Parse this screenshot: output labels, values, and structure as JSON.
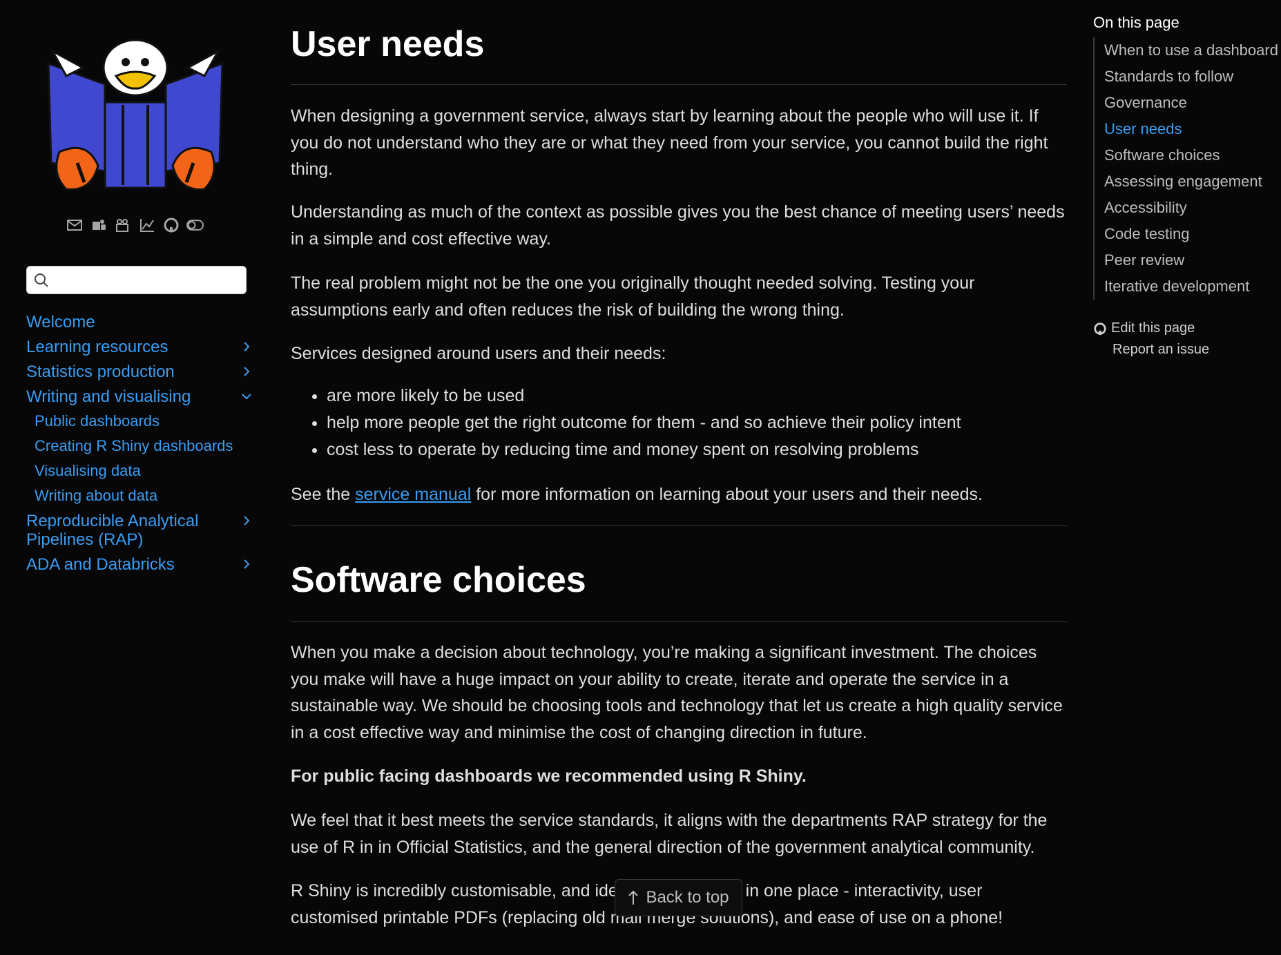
{
  "sidebar": {
    "search": {
      "placeholder": "",
      "value": ""
    },
    "social_icons": [
      "envelope-icon",
      "teams-icon",
      "video-icon",
      "chart-icon",
      "github-icon",
      "toggle-icon"
    ],
    "nav": {
      "welcome": "Welcome",
      "learning_resources": "Learning resources",
      "statistics_production": "Statistics production",
      "writing_visualising": "Writing and visualising",
      "sub": {
        "public_dashboards": "Public dashboards",
        "creating_shiny": "Creating R Shiny dashboards",
        "visualising_data": "Visualising data",
        "writing_about_data": "Writing about data"
      },
      "rap": "Reproducible Analytical Pipelines (RAP)",
      "ada": "ADA and Databricks"
    }
  },
  "main": {
    "section1": {
      "title": "User needs",
      "p1": "When designing a government service, always start by learning about the people who will use it. If you do not understand who they are or what they need from your service, you cannot build the right thing.",
      "p2": "Understanding as much of the context as possible gives you the best chance of meeting users’ needs in a simple and cost effective way.",
      "p3": "The real problem might not be the one you originally thought needed solving. Testing your assumptions early and often reduces the risk of building the wrong thing.",
      "p4": "Services designed around users and their needs:",
      "bullets": [
        "are more likely to be used",
        "help more people get the right outcome for them - and so achieve their policy intent",
        "cost less to operate by reducing time and money spent on resolving problems"
      ],
      "see_pre": "See the ",
      "see_link": "service manual",
      "see_post": " for more information on learning about your users and their needs."
    },
    "section2": {
      "title": "Software choices",
      "p1": "When you make a decision about technology, you’re making a significant investment. The choices you make will have a huge impact on your ability to create, iterate and operate the service in a sustainable way. We should be choosing tools and technology that let us create a high quality service in a cost effective way and minimise the cost of changing direction in future.",
      "bold": "For public facing dashboards we recommended using R Shiny.",
      "p2": "We feel that it best meets the service standards, it aligns with the departments RAP strategy for the use of R in in Official Statistics, and the general direction of the government analytical community.",
      "p3": "R Shiny is incredibly customisable, and ideal for everything in one place - interactivity, user customised printable PDFs (replacing old mail merge solutions), and ease of use on a phone!"
    },
    "back_to_top": "Back to top"
  },
  "toc": {
    "title": "On this page",
    "items": [
      "When to use a dashboard",
      "Standards to follow",
      "Governance",
      "User needs",
      "Software choices",
      "Assessing engagement",
      "Accessibility",
      "Code testing",
      "Peer review",
      "Iterative development"
    ],
    "active": "User needs",
    "edit": "Edit this page",
    "report": "Report an issue"
  },
  "colors": {
    "background": "#070707",
    "link": "#3a9cf2",
    "text": "#dedede",
    "heading": "#ffffff"
  }
}
